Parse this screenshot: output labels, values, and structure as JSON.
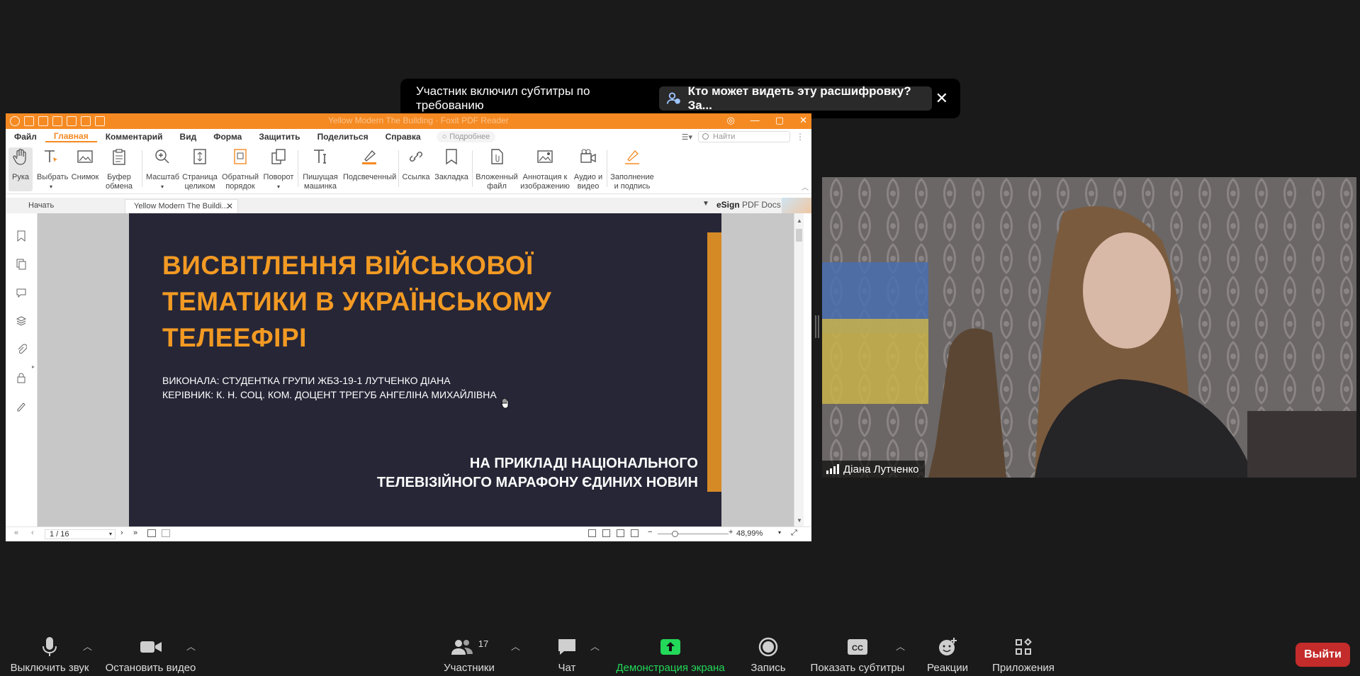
{
  "banner": {
    "message": "Участник включил субтитры по требованию",
    "link": "Кто может видеть эту расшифровку? За...",
    "close": "✕"
  },
  "pdf": {
    "window_title": "Yellow Modern The Building · Foxit PDF Reader",
    "menu": [
      "Файл",
      "Главная",
      "Комментарий",
      "Вид",
      "Форма",
      "Защитить",
      "Поделиться",
      "Справка"
    ],
    "hint": "Подробнее",
    "search_placeholder": "Найти",
    "tools": {
      "hand": "Рука",
      "select": "Выбрать",
      "snapshot": "Снимок",
      "clipboard": "Буфер обмена",
      "zoom": "Масштаб",
      "fit_page": "Страница целиком",
      "reverse": "Обратный порядок",
      "rotate": "Поворот",
      "typewriter": "Пишущая машинка",
      "highlight": "Подсвеченный",
      "link": "Ссылка",
      "bookmark": "Закладка",
      "attach": "Вложенный файл",
      "image_annot": "Аннотация к изображению",
      "audio_video": "Аудио и видео",
      "fill_sign": "Заполнение и подпись"
    },
    "tabs": {
      "start": "Начать",
      "doc": "Yellow Modern The Buildi...",
      "esign": "eSign",
      "pdfdocs": "PDF Docs"
    },
    "slide": {
      "title_l1": "ВИСВІТЛЕННЯ ВІЙСЬКОВОЇ",
      "title_l2": "ТЕМАТИКИ В УКРАЇНСЬКОМУ",
      "title_l3": "ТЕЛЕЕФІРІ",
      "author": "ВИКОНАЛА: СТУДЕНТКА ГРУПИ ЖБЗ-19-1 ЛУТЧЕНКО ДІАНА",
      "supervisor": "КЕРІВНИК: К. Н. СОЦ. КОМ. ДОЦЕНТ ТРЕГУБ АНГЕЛІНА МИХАЙЛІВНА",
      "bottom_l1": "НА ПРИКЛАДІ НАЦІОНАЛЬНОГО",
      "bottom_l2": "ТЕЛЕВІЗІЙНОГО МАРАФОНУ ЄДИНИХ НОВИН"
    },
    "status": {
      "page": "1 / 16",
      "zoom": "48,99%"
    }
  },
  "participant": {
    "name": "Діана Лутченко"
  },
  "toolbar": {
    "mute": "Выключить звук",
    "stop_video": "Остановить видео",
    "participants": "Участники",
    "participants_count": "17",
    "chat": "Чат",
    "share": "Демонстрация экрана",
    "record": "Запись",
    "captions": "Показать субтитры",
    "reactions": "Реакции",
    "apps": "Приложения",
    "leave": "Выйти"
  },
  "colors": {
    "foxit_orange": "#f58a23",
    "slide_bg": "#272637",
    "slide_title": "#f29a23",
    "share_green": "#23d959",
    "leave_red": "#c42b2b"
  }
}
